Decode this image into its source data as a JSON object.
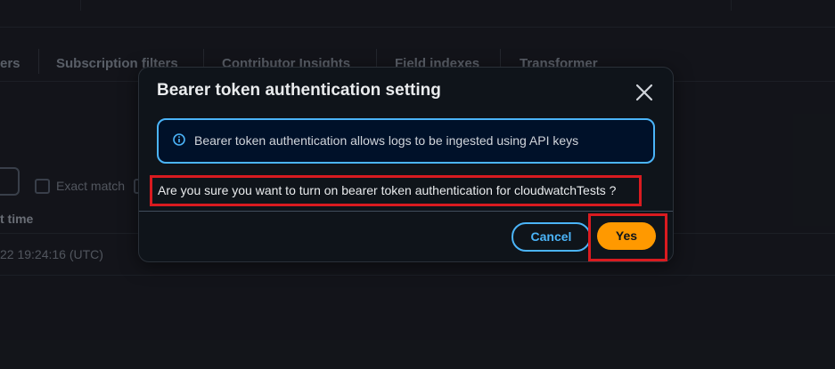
{
  "background": {
    "tabs": [
      "ers",
      "Subscription filters",
      "Contributor Insights",
      "Field indexes",
      "Transformer"
    ],
    "exact_match_label": "Exact match",
    "column_header": "t time",
    "row_timestamp": "22 19:24:16 (UTC)"
  },
  "modal": {
    "title": "Bearer token authentication setting",
    "info_text": "Bearer token authentication allows logs to be ingested using API keys",
    "confirm_text": "Are you sure you want to turn on bearer token authentication for cloudwatchTests ?",
    "cancel_label": "Cancel",
    "yes_label": "Yes"
  },
  "colors": {
    "primary_button": "#ff9900",
    "link_accent": "#4bb4f8",
    "highlight_border": "#d91b20"
  },
  "icons": {
    "close": "close-icon",
    "info": "info-icon"
  }
}
